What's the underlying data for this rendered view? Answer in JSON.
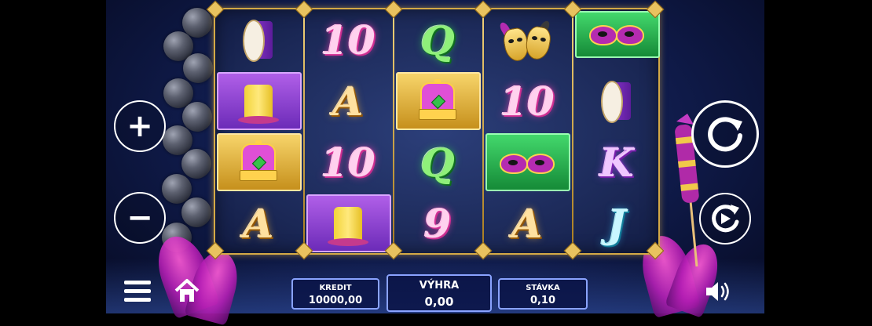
{
  "game": {
    "reels": [
      [
        "drum",
        "purple-hat",
        "gold-crown",
        "A"
      ],
      [
        "10",
        "A",
        "10",
        "purple-hat"
      ],
      [
        "Q",
        "gold-crown",
        "Q",
        "9"
      ],
      [
        "theatre-masks",
        "10",
        "green-mask",
        "A"
      ],
      [
        "green-mask",
        "drum",
        "K",
        "J"
      ]
    ]
  },
  "controls": {
    "plus_icon": "plus-icon",
    "minus_icon": "minus-icon",
    "spin_icon": "spin-refresh-icon",
    "autoplay_icon": "autoplay-icon",
    "menu_icon": "hamburger-menu-icon",
    "home_icon": "home-icon",
    "sound_icon": "speaker-icon",
    "plus_glyph": "+",
    "minus_glyph": "−"
  },
  "panels": {
    "kredit_label": "KREDIT",
    "kredit_value": "10000,00",
    "vyhra_label": "VÝHRA",
    "vyhra_value": "0,00",
    "stavka_label": "STÁVKA",
    "stavka_value": "0,10"
  },
  "cells": {
    "r1c2": "10",
    "r1c3": "A",
    "r1c4": "10",
    "r2c1": "Q",
    "r2c3": "Q",
    "r2c4": "9",
    "r3c2": "10",
    "r3c4": "A",
    "r0c4": "A",
    "r4c3": "K",
    "r4c4": "J"
  },
  "colors": {
    "frame_gold": "#d4a946",
    "panel_border": "#8aa3ff",
    "background": "#0f1a48"
  }
}
